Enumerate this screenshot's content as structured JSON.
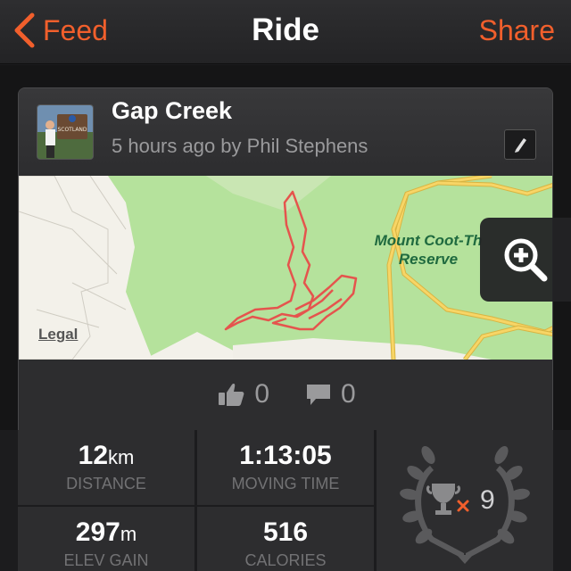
{
  "navbar": {
    "back_label": "Feed",
    "title": "Ride",
    "share_label": "Share"
  },
  "activity": {
    "title": "Gap Creek",
    "subtitle": "5 hours ago by Phil Stephens",
    "avatar_sign_text": "SCOTLAND"
  },
  "map": {
    "legal_label": "Legal",
    "place_label_line1": "Mount Coot-Th",
    "place_label_line2": "Reserve"
  },
  "social": {
    "kudos_count": "0",
    "comments_count": "0"
  },
  "stats": {
    "distance_value": "12",
    "distance_unit": "km",
    "distance_label": "DISTANCE",
    "moving_time_value": "1:13:05",
    "moving_time_label": "MOVING TIME",
    "elev_value": "297",
    "elev_unit": "m",
    "elev_label": "ELEV GAIN",
    "calories_value": "516",
    "calories_label": "CALORIES",
    "achievements_count": "9"
  },
  "colors": {
    "accent": "#f15f2c",
    "route": "#e5544d"
  }
}
